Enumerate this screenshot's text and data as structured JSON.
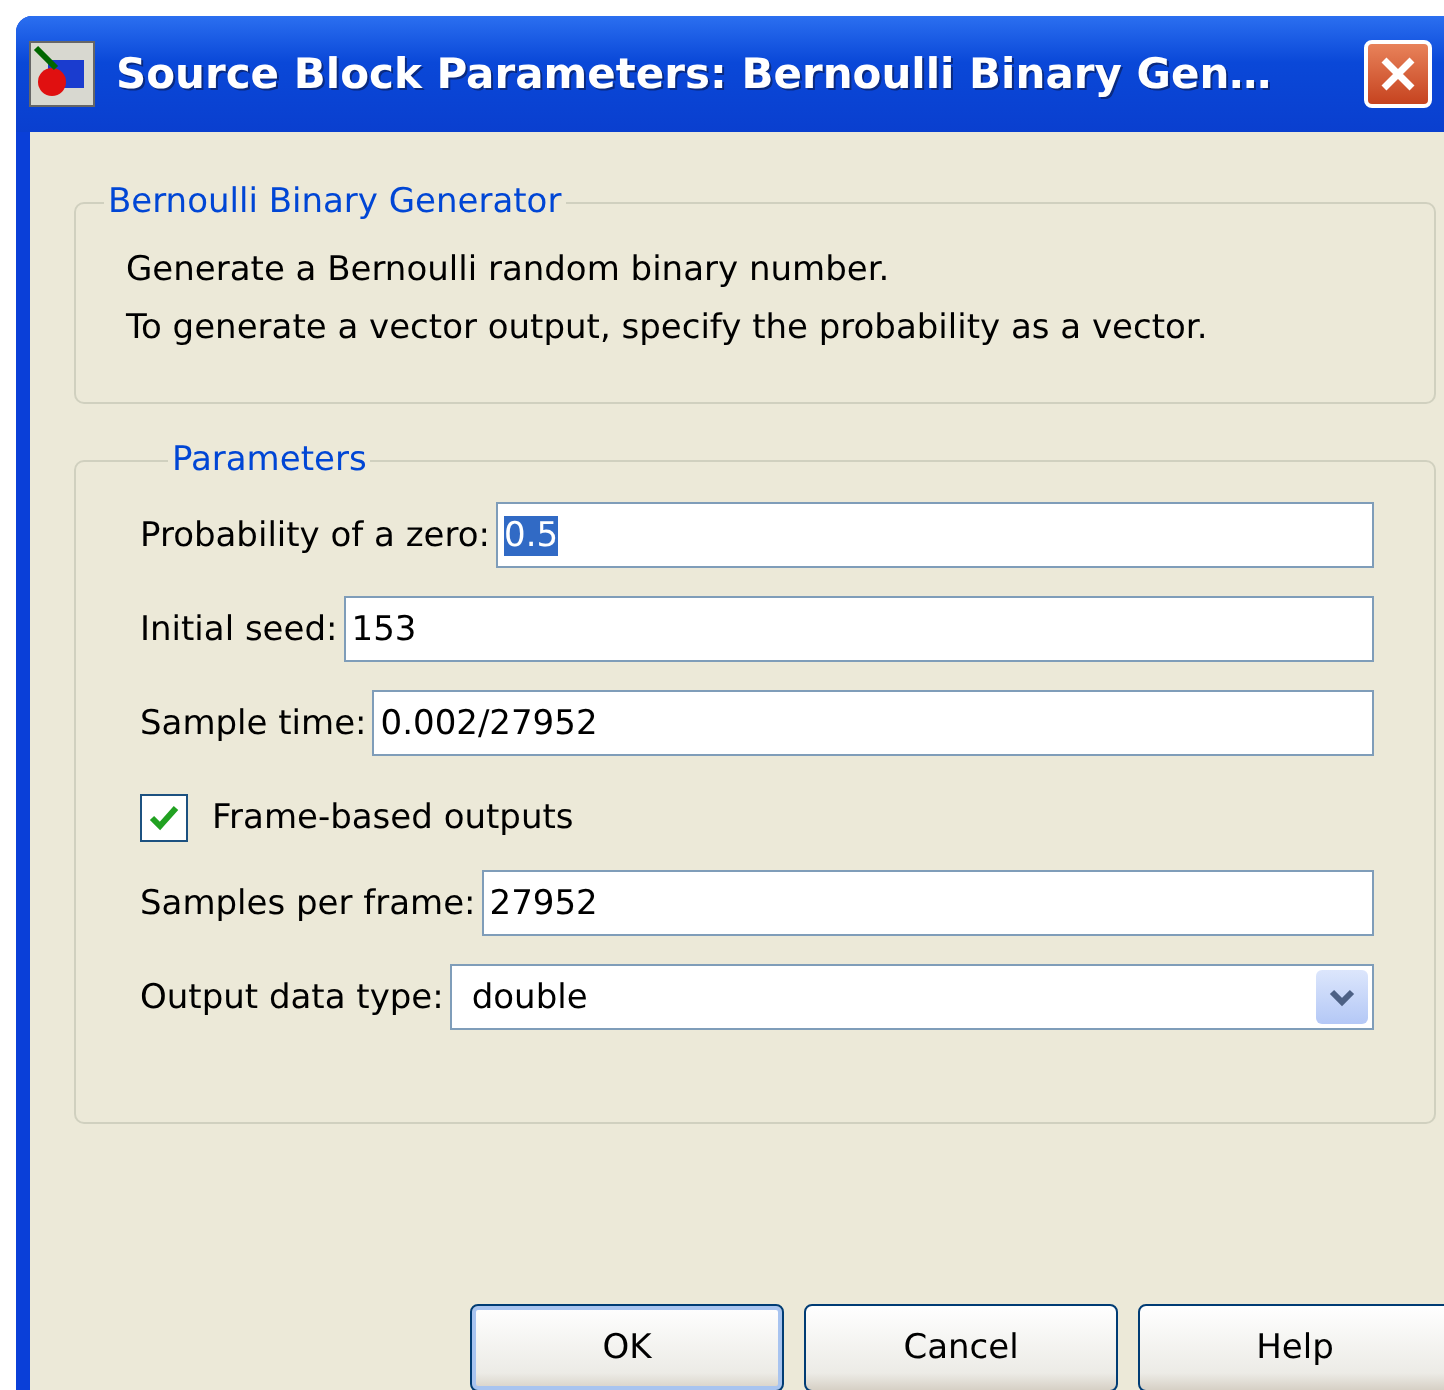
{
  "window": {
    "title": "Source Block Parameters: Bernoulli Binary Gen…"
  },
  "description_group": {
    "legend": "Bernoulli Binary Generator",
    "lines": [
      "Generate a Bernoulli random binary number.",
      "To generate a vector output, specify the probability as a vector."
    ]
  },
  "parameters_group": {
    "legend": "Parameters",
    "items": [
      {
        "kind": "text",
        "label": "Probability of a zero:",
        "value": "0.5",
        "highlighted": true
      },
      {
        "kind": "text",
        "label": "Initial seed:",
        "value": "153",
        "highlighted": false
      },
      {
        "kind": "text",
        "label": "Sample time:",
        "value": "0.002/27952",
        "highlighted": false
      },
      {
        "kind": "checkbox",
        "label": "Frame-based outputs",
        "checked": true
      },
      {
        "kind": "text",
        "label": "Samples per frame:",
        "value": "27952",
        "highlighted": false
      },
      {
        "kind": "dropdown",
        "label": "Output data type:",
        "value": "double"
      }
    ]
  },
  "buttons": [
    {
      "label": "OK",
      "default": true
    },
    {
      "label": "Cancel",
      "default": false
    },
    {
      "label": "Help",
      "default": false
    }
  ]
}
